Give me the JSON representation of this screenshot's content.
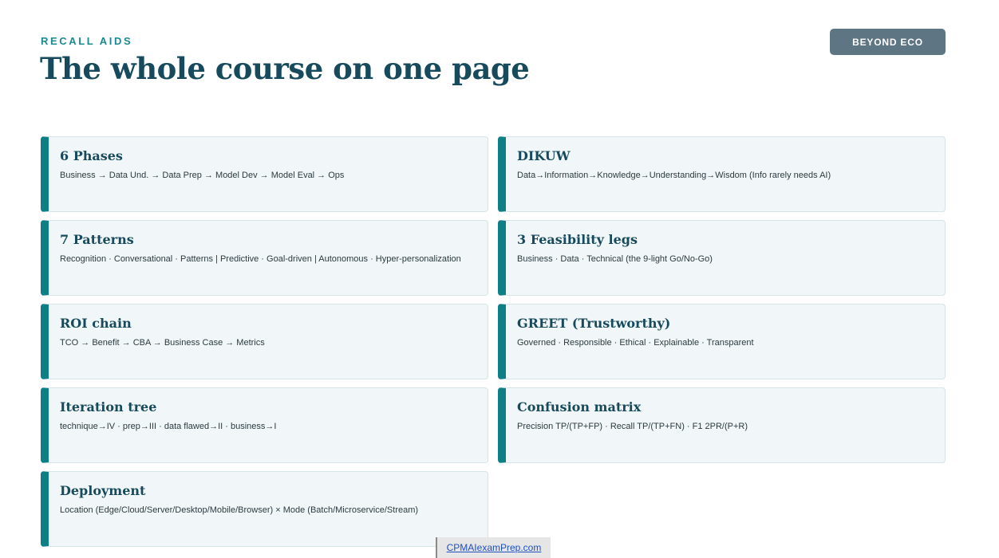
{
  "header": {
    "eyebrow": "RECALL AIDS",
    "title": "The whole course on one page",
    "badge": "BEYOND ECO"
  },
  "cards": [
    {
      "title": "6 Phases",
      "body": "Business → Data Und. → Data Prep → Model Dev → Model Eval → Ops"
    },
    {
      "title": "DIKUW",
      "body": "Data→Information→Knowledge→Understanding→Wisdom (Info rarely needs AI)"
    },
    {
      "title": "7 Patterns",
      "body": "Recognition · Conversational · Patterns | Predictive · Goal-driven | Autonomous · Hyper-personalization"
    },
    {
      "title": "3 Feasibility legs",
      "body": "Business · Data · Technical (the 9-light Go/No-Go)"
    },
    {
      "title": "ROI chain",
      "body": "TCO → Benefit → CBA → Business Case → Metrics"
    },
    {
      "title": "GREET (Trustworthy)",
      "body": "Governed · Responsible · Ethical · Explainable · Transparent"
    },
    {
      "title": "Iteration tree",
      "body": "technique→IV · prep→III · data flawed→II · business→I"
    },
    {
      "title": "Confusion matrix",
      "body": "Precision TP/(TP+FP) · Recall TP/(TP+FN) · F1 2PR/(P+R)"
    },
    {
      "title": "Deployment",
      "body": "Location (Edge/Cloud/Server/Desktop/Mobile/Browser) × Mode (Batch/Microservice/Stream)"
    }
  ],
  "footer": {
    "link": "CPMAIexamPrep.com"
  }
}
